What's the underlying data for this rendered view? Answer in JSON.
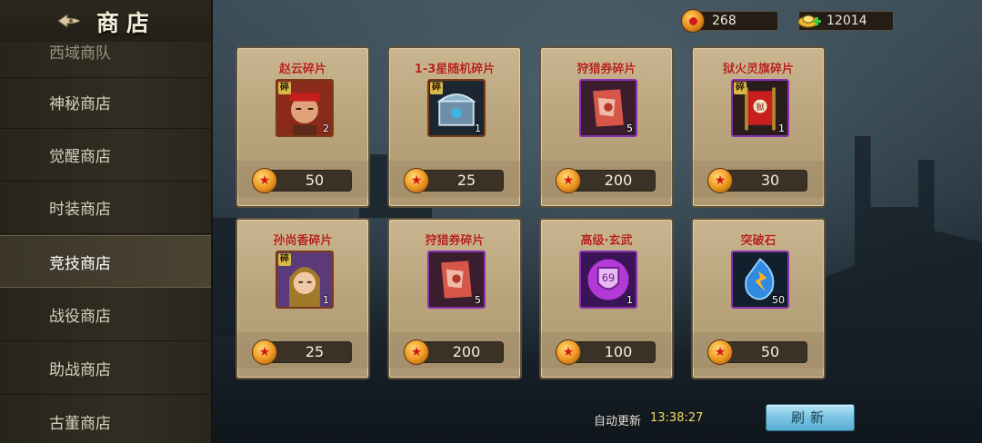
{
  "header": {
    "title": "商店"
  },
  "sidebar": {
    "items": [
      {
        "label": "西域商队",
        "state": "partial"
      },
      {
        "label": "神秘商店"
      },
      {
        "label": "觉醒商店"
      },
      {
        "label": "时装商店"
      },
      {
        "label": "竞技商店",
        "state": "active"
      },
      {
        "label": "战役商店"
      },
      {
        "label": "助战商店"
      },
      {
        "label": "古董商店"
      }
    ]
  },
  "currency": {
    "coins": "268",
    "ingots": "12014"
  },
  "shop_items": [
    {
      "name": "赵云碎片",
      "qty": "2",
      "price": "50",
      "shard": "碎",
      "icon": "zhaoyun-portrait-icon",
      "frame": "orange"
    },
    {
      "name": "1-3星随机碎片",
      "qty": "1",
      "price": "25",
      "shard": "碎",
      "icon": "treasure-chest-icon",
      "frame": "orange"
    },
    {
      "name": "狩猎券碎片",
      "qty": "5",
      "price": "200",
      "shard": "",
      "icon": "scroll-icon",
      "frame": "purple"
    },
    {
      "name": "狱火灵旗碎片",
      "qty": "1",
      "price": "30",
      "shard": "碎",
      "icon": "flag-icon",
      "frame": "purple"
    },
    {
      "name": "孙尚香碎片",
      "qty": "1",
      "price": "25",
      "shard": "碎",
      "icon": "sunshangxiang-portrait-icon",
      "frame": "orange"
    },
    {
      "name": "狩猎券碎片",
      "qty": "5",
      "price": "200",
      "shard": "",
      "icon": "scroll-icon",
      "frame": "purple"
    },
    {
      "name": "高级·玄武",
      "qty": "1",
      "price": "100",
      "shard": "",
      "icon": "badge-icon",
      "frame": "purple"
    },
    {
      "name": "突破石",
      "qty": "50",
      "price": "50",
      "shard": "",
      "icon": "blue-gem-icon",
      "frame": "purple"
    }
  ],
  "footer": {
    "refresh_label": "自动更新",
    "refresh_time": "13:38:27",
    "refresh_button": "刷新"
  }
}
